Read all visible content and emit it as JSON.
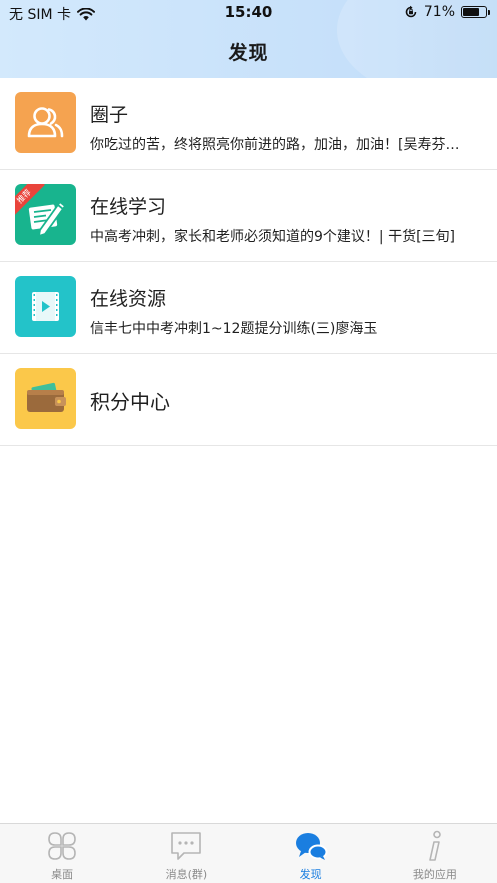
{
  "status_bar": {
    "carrier": "无 SIM 卡",
    "time": "15:40",
    "battery_percent": "71%",
    "battery_level": 0.71
  },
  "header": {
    "title": "发现"
  },
  "list": {
    "items": [
      {
        "name": "圈子",
        "desc": "你吃过的苦，终将照亮你前进的路，加油，加油！[吴寿芬…",
        "icon": "people-icon",
        "color": "#f5a350"
      },
      {
        "name": "在线学习",
        "desc": "中高考冲刺，家长和老师必须知道的9个建议！| 干货[三旬]",
        "icon": "pencil-icon",
        "color": "#18b48e",
        "badge": "推荐"
      },
      {
        "name": "在线资源",
        "desc": "信丰七中中考冲刺1~12题提分训练(三)廖海玉",
        "icon": "video-icon",
        "color": "#23c3c9"
      },
      {
        "name": "积分中心",
        "icon": "wallet-icon",
        "color": "#fbc84a"
      }
    ]
  },
  "tabbar": {
    "active": 2,
    "tabs": [
      {
        "label": "桌面",
        "icon": "desktop-icon"
      },
      {
        "label": "消息(群)",
        "icon": "message-icon"
      },
      {
        "label": "发现",
        "icon": "discover-icon"
      },
      {
        "label": "我的应用",
        "icon": "info-icon"
      }
    ],
    "active_color": "#1a7ee0",
    "inactive_color": "#b5b5b5"
  }
}
